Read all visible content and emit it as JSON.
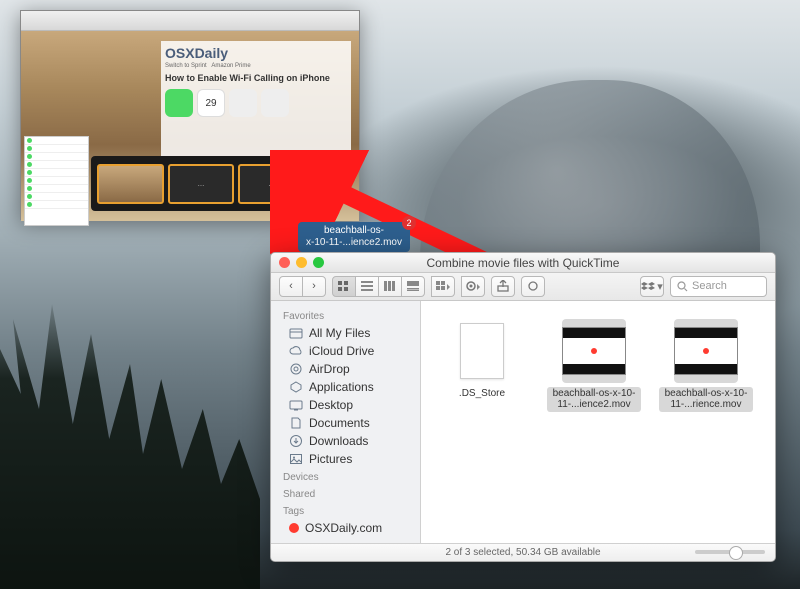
{
  "qt": {
    "logo": "OSXDaily",
    "headline": "How to Enable Wi-Fi Calling on iPhone",
    "banner1": "Switch to Sprint",
    "banner2": "Amazon Prime",
    "clip_placeholders": [
      "",
      "...",
      "..."
    ]
  },
  "drag": {
    "filename_l1": "beachball-os-",
    "filename_l2": "x-10-11-...ience2.mov",
    "count": "2"
  },
  "finder": {
    "title": "Combine movie files with QuickTime",
    "toolbar": {
      "back": "‹",
      "forward": "›",
      "dropbox": "⧈",
      "search_placeholder": "Search"
    },
    "sidebar": {
      "favorites_header": "Favorites",
      "favorites": [
        {
          "label": "All My Files",
          "icon": "all-files"
        },
        {
          "label": "iCloud Drive",
          "icon": "cloud"
        },
        {
          "label": "AirDrop",
          "icon": "airdrop"
        },
        {
          "label": "Applications",
          "icon": "apps"
        },
        {
          "label": "Desktop",
          "icon": "desktop"
        },
        {
          "label": "Documents",
          "icon": "documents"
        },
        {
          "label": "Downloads",
          "icon": "downloads"
        },
        {
          "label": "Pictures",
          "icon": "pictures"
        }
      ],
      "devices_header": "Devices",
      "shared_header": "Shared",
      "tags_header": "Tags",
      "tags": [
        {
          "label": "OSXDaily.com",
          "color": "#ff3b30"
        }
      ]
    },
    "files": [
      {
        "name": ".DS_Store",
        "type": "blank",
        "selected": false
      },
      {
        "name": "beachball-os-x-10-11-...ience2.mov",
        "type": "mov",
        "selected": true
      },
      {
        "name": "beachball-os-x-10-11-...rience.mov",
        "type": "mov",
        "selected": true
      }
    ],
    "status": "2 of 3 selected, 50.34 GB available"
  }
}
